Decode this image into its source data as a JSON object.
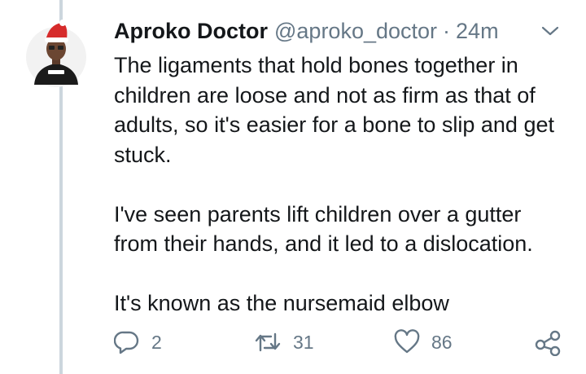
{
  "tweet": {
    "display_name": "Aproko Doctor",
    "handle": "@aproko_doctor",
    "separator": "·",
    "time": "24m",
    "paragraphs": [
      "The ligaments that hold bones together in children are loose and not as firm as that of adults, so it's easier for a bone to slip and get stuck.",
      "I've seen parents lift children over a gutter from their hands, and it led to a dislocation.",
      "It's known as the nursemaid elbow"
    ]
  },
  "actions": {
    "reply_count": "2",
    "retweet_count": "31",
    "like_count": "86"
  },
  "icons": {
    "reply": "reply-icon",
    "retweet": "retweet-icon",
    "like": "heart-icon",
    "share": "share-icon",
    "caret": "chevron-down-icon"
  },
  "colors": {
    "text": "#14171a",
    "secondary": "#657786",
    "thread_line": "#ccd6dd",
    "hat_red": "#d62b2b"
  }
}
